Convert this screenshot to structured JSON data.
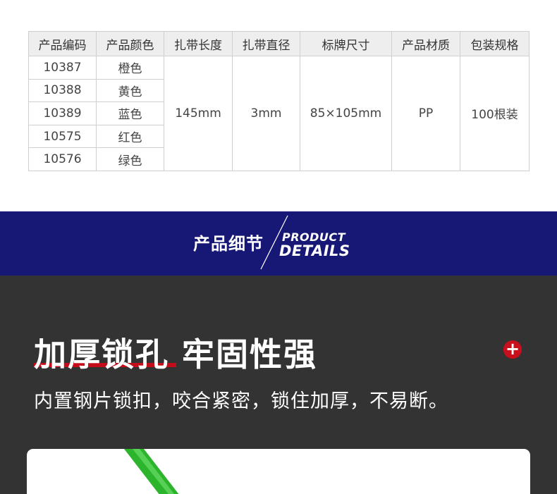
{
  "table": {
    "headers": [
      "产品编码",
      "产品颜色",
      "扎带长度",
      "扎带直径",
      "标牌尺寸",
      "产品材质",
      "包装规格"
    ],
    "rows": [
      {
        "code": "10387",
        "color": "橙色"
      },
      {
        "code": "10388",
        "color": "黄色"
      },
      {
        "code": "10389",
        "color": "蓝色"
      },
      {
        "code": "10575",
        "color": "红色"
      },
      {
        "code": "10576",
        "color": "绿色"
      }
    ],
    "shared": {
      "length": "145mm",
      "diameter": "3mm",
      "tag_size": "85×105mm",
      "material": "PP",
      "packaging": "100根装"
    }
  },
  "banner": {
    "title_cn": "产品细节",
    "title_en_1": "PRODUCT",
    "title_en_2": "DETAILS",
    "background": "#171776"
  },
  "detail": {
    "headline": "加厚锁孔 牢固性强",
    "subline": "内置钢片锁扣，咬合紧密，锁住加厚，不易断。",
    "plus_icon": "plus-icon",
    "accent": "#c40d1b",
    "background": "#333333",
    "strap_color": "#2cb52c"
  }
}
